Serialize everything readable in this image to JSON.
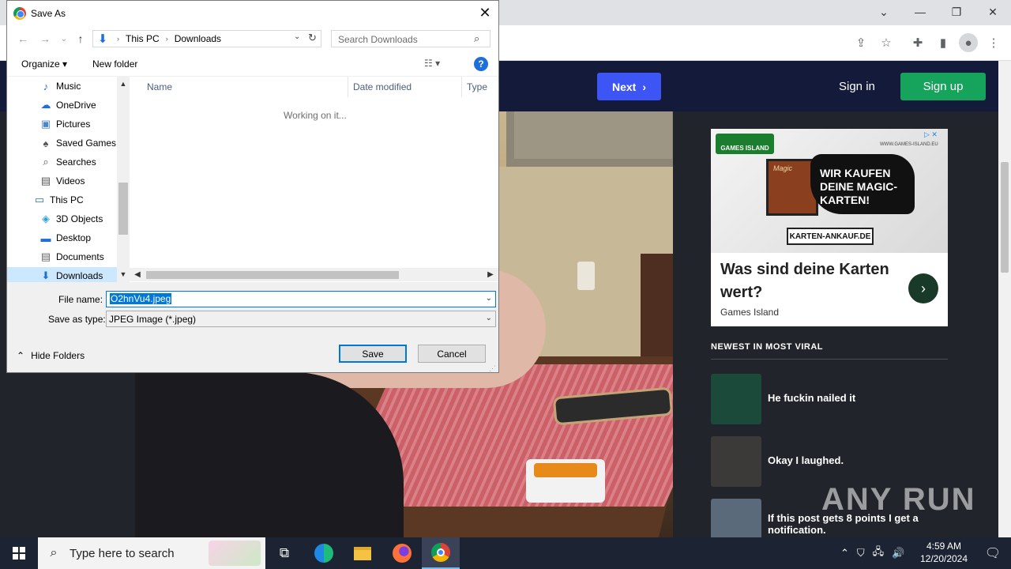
{
  "dialog": {
    "title": "Save As",
    "close_symbol": "✕",
    "back_symbol": "←",
    "forward_symbol": "→",
    "recent_symbol": "⌄",
    "up_symbol": "↑",
    "breadcrumb": [
      "This PC",
      "Downloads"
    ],
    "search_placeholder": "Search Downloads",
    "organize_label": "Organize ▾",
    "new_folder_label": "New folder",
    "view_label": "☷ ▾",
    "help_symbol": "?",
    "tree": [
      {
        "label": "Music",
        "icon": "music-icon",
        "glyph": "♪",
        "color": "#1e6fd9"
      },
      {
        "label": "OneDrive",
        "icon": "cloud-icon",
        "glyph": "☁",
        "color": "#1e6fd9"
      },
      {
        "label": "Pictures",
        "icon": "pictures-icon",
        "glyph": "▣",
        "color": "#4a87c6"
      },
      {
        "label": "Saved Games",
        "icon": "saved-games-icon",
        "glyph": "♠",
        "color": "#555"
      },
      {
        "label": "Searches",
        "icon": "search-icon",
        "glyph": "⌕",
        "color": "#555"
      },
      {
        "label": "Videos",
        "icon": "videos-icon",
        "glyph": "▤",
        "color": "#555"
      },
      {
        "label": "This PC",
        "icon": "computer-icon",
        "glyph": "▭",
        "color": "#1e6fd9"
      },
      {
        "label": "3D Objects",
        "icon": "cube-icon",
        "glyph": "◈",
        "color": "#28a0d8"
      },
      {
        "label": "Desktop",
        "icon": "desktop-icon",
        "glyph": "▬",
        "color": "#1e6fd9"
      },
      {
        "label": "Documents",
        "icon": "documents-icon",
        "glyph": "▤",
        "color": "#666"
      },
      {
        "label": "Downloads",
        "icon": "download-icon",
        "glyph": "⬇",
        "color": "#1e6fd9"
      }
    ],
    "selected_tree_item": "Downloads",
    "columns": [
      "Name",
      "Date modified",
      "Type"
    ],
    "status_text": "Working on it...",
    "file_name_label": "File name:",
    "file_name_value": "O2hnVu4.jpeg",
    "save_type_label": "Save as type:",
    "save_type_value": "JPEG Image (*.jpeg)",
    "hide_folders_label": "Hide Folders",
    "save_label": "Save",
    "cancel_label": "Cancel"
  },
  "site": {
    "next_label": "Next",
    "sign_in_label": "Sign in",
    "sign_up_label": "Sign up",
    "ad": {
      "brand": "GAMES ISLAND",
      "url": "WWW.GAMES-ISLAND.EU",
      "card_text": "Magic",
      "headline": "WIR KAUFEN DEINE MAGIC-KARTEN!",
      "domain": "KARTEN-ANKAUF.DE",
      "question": "Was sind deine Karten wert?",
      "advertiser": "Games Island"
    },
    "newest_heading": "NEWEST IN MOST VIRAL",
    "viral_items": [
      {
        "title": "He fuckin nailed it",
        "color": "#1c4a3a"
      },
      {
        "title": "Okay I laughed.",
        "color": "#3b3a38"
      },
      {
        "title": "If this post gets 8 points I get a notification.",
        "color": "#5b6a7a"
      }
    ],
    "watermark": "ANY RUN"
  },
  "taskbar": {
    "search_placeholder": "Type here to search",
    "time": "4:59 AM",
    "date": "12/20/2024"
  },
  "colors": {
    "accent": "#0078d7",
    "site_header": "#141b3a",
    "next_button": "#3d55f5",
    "signup_button": "#16a35b"
  }
}
